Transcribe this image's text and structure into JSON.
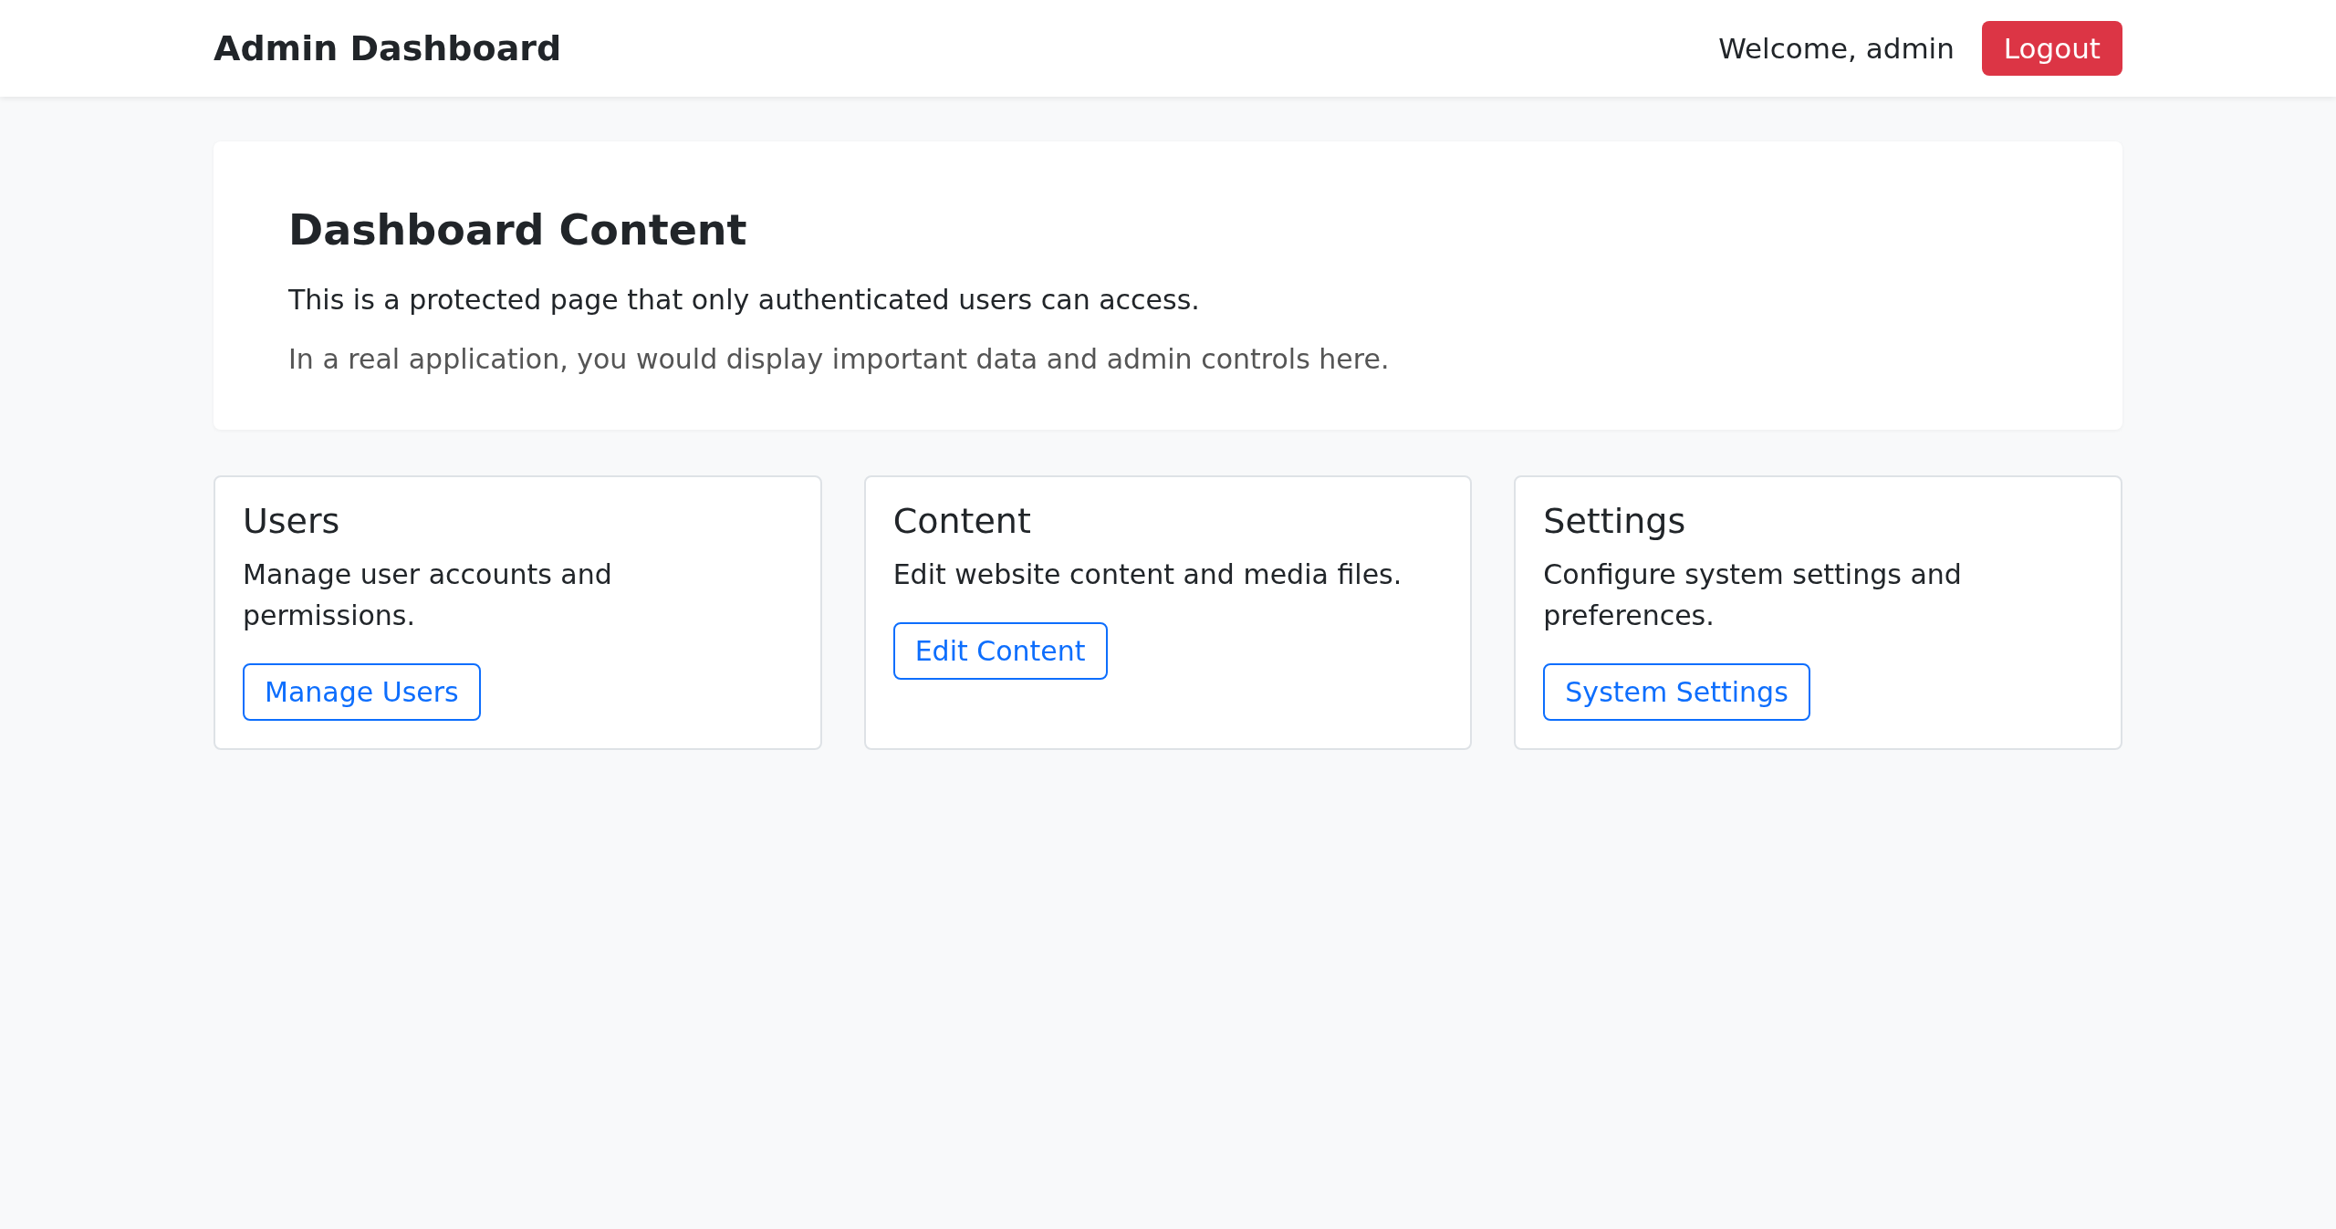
{
  "navbar": {
    "brand": "Admin Dashboard",
    "welcome": "Welcome, admin",
    "logout": "Logout"
  },
  "intro": {
    "title": "Dashboard Content",
    "text": "This is a protected page that only authenticated users can access.",
    "note": "In a real application, you would display important data and admin controls here."
  },
  "cards": [
    {
      "title": "Users",
      "text": "Manage user accounts and permissions.",
      "button": "Manage Users"
    },
    {
      "title": "Content",
      "text": "Edit website content and media files.",
      "button": "Edit Content"
    },
    {
      "title": "Settings",
      "text": "Configure system settings and preferences.",
      "button": "System Settings"
    }
  ]
}
